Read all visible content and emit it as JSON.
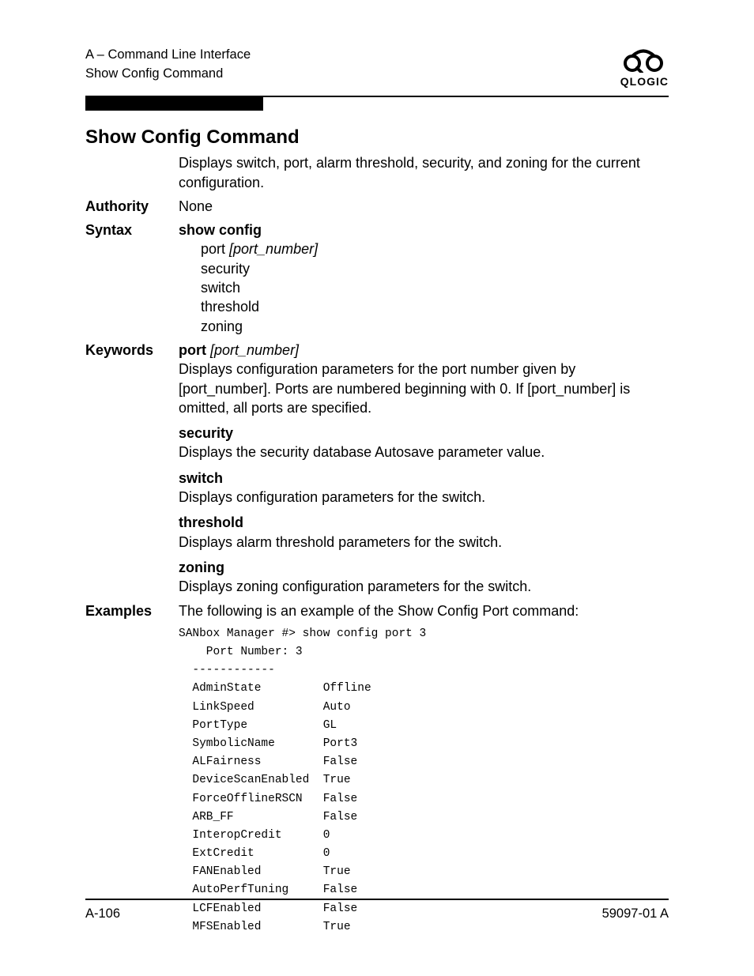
{
  "header": {
    "line1": "A – Command Line Interface",
    "line2": "Show Config Command",
    "logo_label": "QLOGIC"
  },
  "title": "Show Config Command",
  "intro": "Displays switch, port, alarm threshold, security, and zoning for the current configuration.",
  "authority": {
    "label": "Authority",
    "value": "None"
  },
  "syntax": {
    "label": "Syntax",
    "cmd": "show config",
    "lines": [
      "port ",
      "security",
      "switch",
      "threshold",
      "zoning"
    ],
    "port_arg": "[port_number]"
  },
  "keywords": {
    "label": "Keywords",
    "items": [
      {
        "kw": "port ",
        "arg": "[port_number]",
        "desc": "Displays configuration parameters for the port number given by [port_number]. Ports are numbered beginning with 0. If [port_number] is omitted, all ports are specified."
      },
      {
        "kw": "security",
        "desc": "Displays the security database Autosave parameter value."
      },
      {
        "kw": "switch",
        "desc": "Displays configuration parameters for the switch."
      },
      {
        "kw": "threshold",
        "desc": "Displays alarm threshold parameters for the switch."
      },
      {
        "kw": "zoning",
        "desc": "Displays zoning configuration parameters for the switch."
      }
    ]
  },
  "examples": {
    "label": "Examples",
    "lead": "The following is an example of the Show Config Port command:",
    "code": "SANbox Manager #> show config port 3\n    Port Number: 3\n  ------------\n  AdminState         Offline\n  LinkSpeed          Auto\n  PortType           GL\n  SymbolicName       Port3\n  ALFairness         False\n  DeviceScanEnabled  True\n  ForceOfflineRSCN   False\n  ARB_FF             False\n  InteropCredit      0\n  ExtCredit          0\n  FANEnabled         True\n  AutoPerfTuning     False\n  LCFEnabled         False\n  MFSEnabled         True"
  },
  "footer": {
    "left": "A-106",
    "right": "59097-01 A"
  }
}
